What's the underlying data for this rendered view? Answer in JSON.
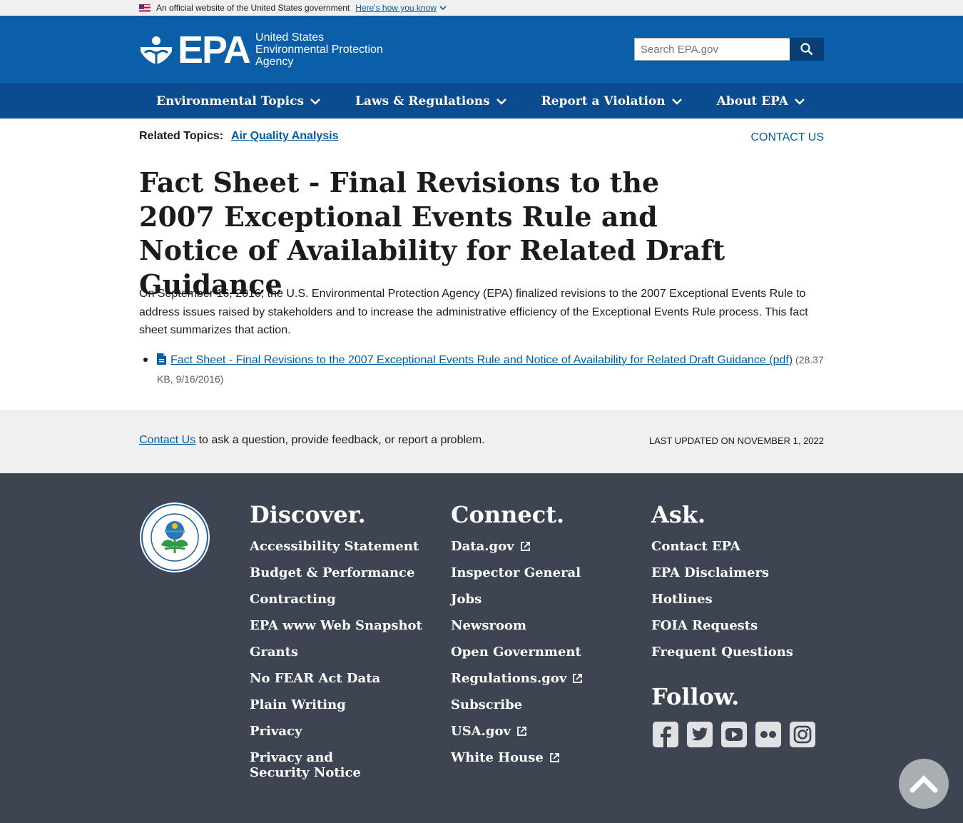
{
  "gov_banner": {
    "text": "An official website of the United States government",
    "link": "Here's how you know"
  },
  "header": {
    "logo_text": "EPA",
    "agency_line1": "United States",
    "agency_line2": "Environmental Protection",
    "agency_line3": "Agency",
    "search_placeholder": "Search EPA.gov"
  },
  "nav": {
    "items": [
      {
        "label": "Environmental Topics"
      },
      {
        "label": "Laws & Regulations"
      },
      {
        "label": "Report a Violation"
      },
      {
        "label": "About EPA"
      }
    ]
  },
  "related": {
    "label": "Related Topics:",
    "link": "Air Quality Analysis"
  },
  "contact_top": "CONTACT US",
  "page": {
    "title": "Fact Sheet - Final Revisions to the 2007 Exceptional Events Rule and Notice of Availability for Related Draft Guidance",
    "intro": "On September 16, 2016, the U.S. Environmental Protection Agency (EPA) finalized revisions to the 2007 Exceptional Events Rule to address issues raised by stakeholders and to increase the administrative efficiency of the Exceptional Events Rule process. This fact sheet summarizes that action.",
    "doc_link": "Fact Sheet - Final Revisions to the 2007 Exceptional Events Rule and Notice of Availability for Related Draft Guidance (pdf)",
    "doc_meta": " (28.37 KB, 9/16/2016)"
  },
  "feedback": {
    "link": "Contact Us",
    "text": " to ask a question, provide feedback, or report a problem.",
    "updated": "LAST UPDATED ON NOVEMBER 1, 2022"
  },
  "footer": {
    "discover": {
      "heading": "Discover.",
      "items": [
        "Accessibility Statement",
        "Budget & Performance",
        "Contracting",
        "EPA www Web Snapshot",
        "Grants",
        "No FEAR Act Data",
        "Plain Writing",
        "Privacy",
        "Privacy and Security Notice"
      ]
    },
    "connect": {
      "heading": "Connect.",
      "items": [
        "Data.gov",
        "Inspector General",
        "Jobs",
        "Newsroom",
        "Open Government",
        "Regulations.gov",
        "Subscribe",
        "USA.gov",
        "White House"
      ]
    },
    "ask": {
      "heading": "Ask.",
      "items": [
        "Contact EPA",
        "EPA Disclaimers",
        "Hotlines",
        "FOIA Requests",
        "Frequent Questions"
      ]
    },
    "follow": {
      "heading": "Follow.",
      "icons": [
        "facebook-icon",
        "twitter-icon",
        "youtube-icon",
        "flickr-icon",
        "instagram-icon"
      ]
    }
  },
  "colors": {
    "header_blue": "#0b5ea8",
    "nav_blue": "#0b4b8f",
    "link_blue": "#005ea2",
    "footer_bg": "#3d4552"
  }
}
